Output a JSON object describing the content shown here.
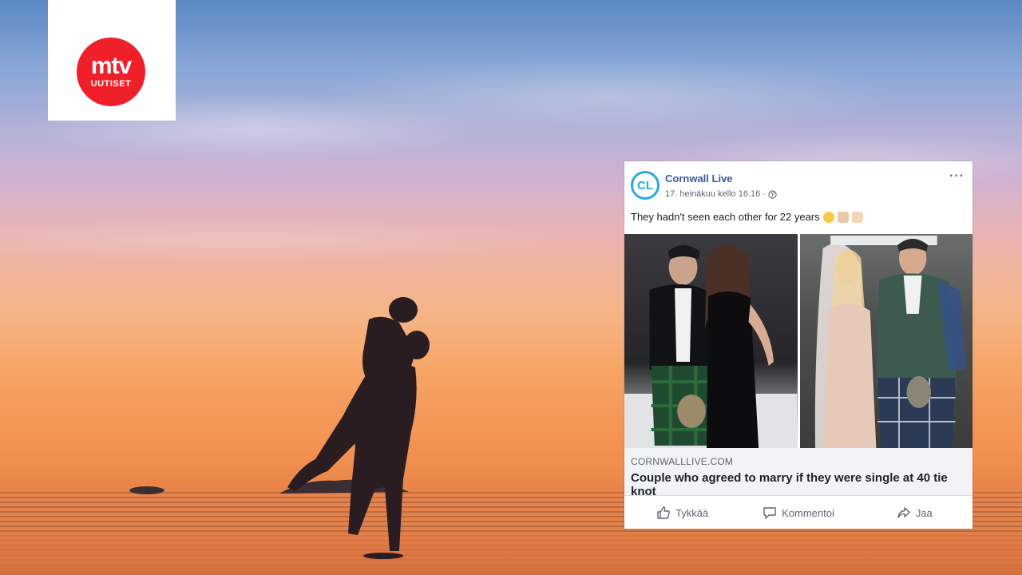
{
  "brand": {
    "logo_main": "mtv",
    "logo_sub": "UUTISET",
    "logo_color": "#f0202a"
  },
  "post": {
    "avatar_text": "CL",
    "page_name": "Cornwall Live",
    "meta": "17. heinäkuu kello 16.16 ·",
    "caption": "They hadn't seen each other for 22 years",
    "link_domain": "CORNWALLLIVE.COM",
    "link_title": "Couple who agreed to marry if they were single at 40 tie knot",
    "actions": {
      "like": "Tykkää",
      "comment": "Kommentoi",
      "share": "Jaa"
    }
  },
  "icons": [
    "globe-icon",
    "more-icon",
    "like-icon",
    "comment-icon",
    "share-icon"
  ],
  "colors": {
    "link_blue": "#385898",
    "facebook_text": "#1d2129"
  }
}
